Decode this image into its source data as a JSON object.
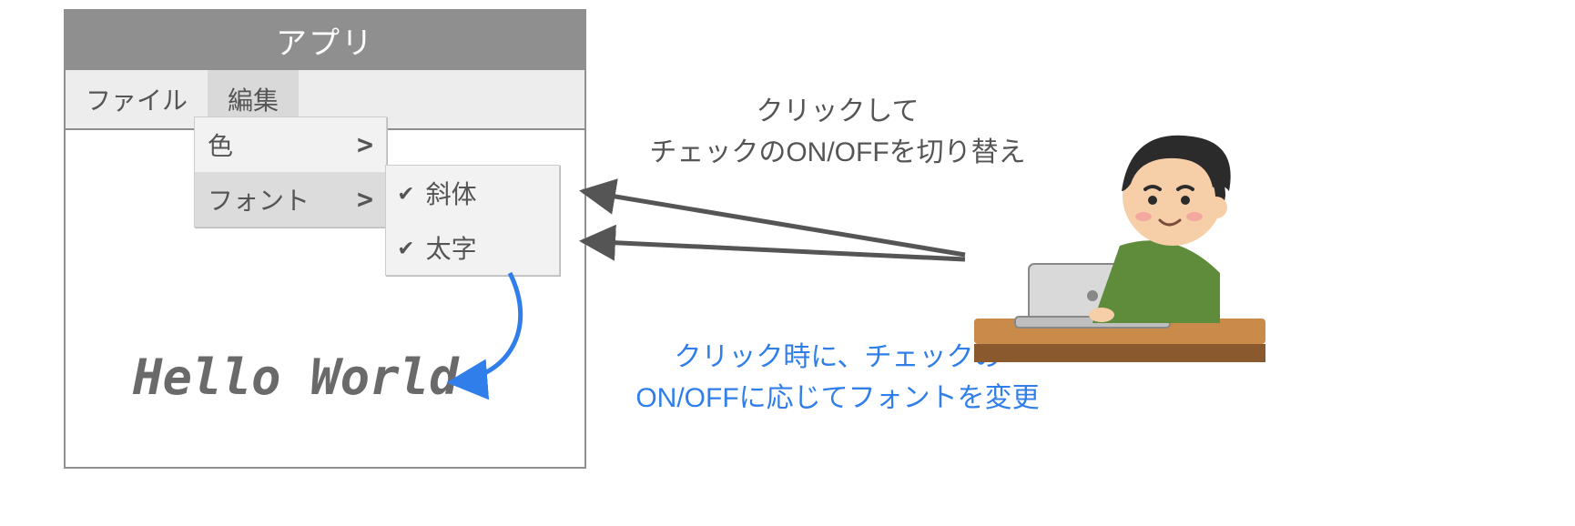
{
  "app": {
    "title": "アプリ",
    "menubar": {
      "file": "ファイル",
      "edit": "編集"
    },
    "submenu": {
      "color": {
        "label": "色",
        "arrow": ">"
      },
      "font": {
        "label": "フォント",
        "arrow": ">"
      }
    },
    "checkmenu": {
      "italic": {
        "check": "✔",
        "label": "斜体"
      },
      "bold": {
        "check": "✔",
        "label": "太字"
      }
    },
    "display_text": "Hello World"
  },
  "annotations": {
    "top_line1": "クリックして",
    "top_line2": "チェックのON/OFFを切り替え",
    "bottom_line1": "クリック時に、チェックの",
    "bottom_line2": "ON/OFFに応じてフォントを変更"
  }
}
